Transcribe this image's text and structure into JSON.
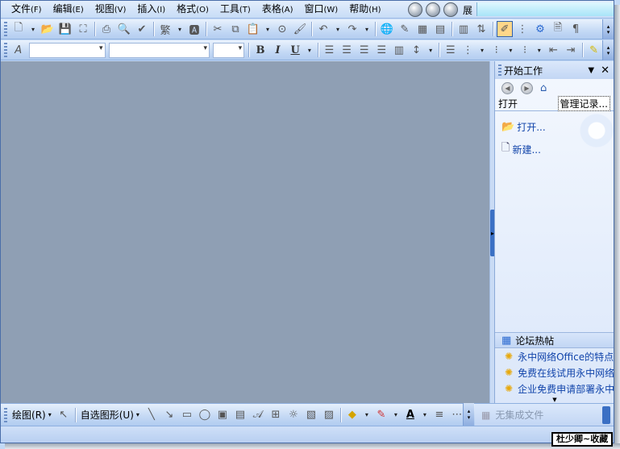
{
  "menu": {
    "items": [
      {
        "label": "文件",
        "accel": "(F)"
      },
      {
        "label": "编辑",
        "accel": "(E)"
      },
      {
        "label": "视图",
        "accel": "(V)"
      },
      {
        "label": "插入",
        "accel": "(I)"
      },
      {
        "label": "格式",
        "accel": "(O)"
      },
      {
        "label": "工具",
        "accel": "(T)"
      },
      {
        "label": "表格",
        "accel": "(A)"
      },
      {
        "label": "窗口",
        "accel": "(W)"
      },
      {
        "label": "帮助",
        "accel": "(H)"
      }
    ],
    "extra_label": "展"
  },
  "toolbar": {
    "style_glyph": "A",
    "font_combo_value": "",
    "size_combo_value": "",
    "bold": "B",
    "italic": "I",
    "underline": "U"
  },
  "taskpane": {
    "title": "开始工作",
    "section_open": "打开",
    "manage_label": "管理记录...",
    "open_link": "打开...",
    "new_link": "新建..."
  },
  "forum": {
    "title": "论坛热帖",
    "items": [
      "永中网络Office的特点",
      "免费在线试用永中网络Office",
      "企业免费申请部署永中网络Office"
    ]
  },
  "drawbar": {
    "draw_label": "绘图",
    "draw_accel": "(R)",
    "autoshape_label": "自选图形",
    "autoshape_accel": "(U)",
    "font_color_glyph": "A"
  },
  "status": {
    "unsaved": "无集成文件"
  },
  "watermark": "杜少卿~收藏",
  "colors": {
    "doc_background": "#8f9fb4",
    "chrome": "#c3d9f5",
    "link": "#1144aa"
  }
}
